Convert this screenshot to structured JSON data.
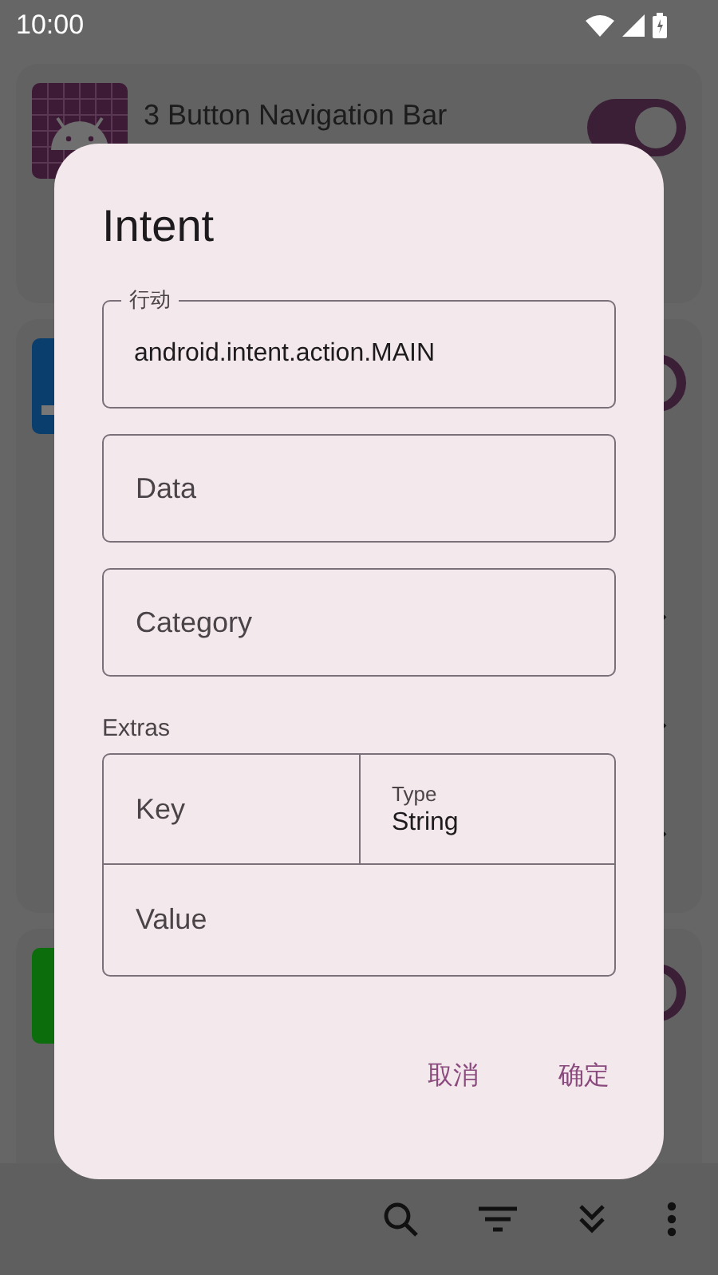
{
  "status_bar": {
    "time": "10:00"
  },
  "cards": [
    {
      "kind": "app",
      "title": "3 Button Navigation Bar",
      "toggle": {
        "on": true
      }
    },
    {
      "kind": "sections",
      "toggle": {
        "on": true
      }
    },
    {
      "kind": "app",
      "toggle": {
        "on": true
      }
    }
  ],
  "dialog": {
    "title": "Intent",
    "fields": [
      {
        "label": "行动",
        "value": "android.intent.action.MAIN"
      },
      {
        "placeholder": "Data"
      },
      {
        "placeholder": "Category"
      }
    ],
    "extras": {
      "label": "Extras",
      "key": {
        "placeholder": "Key"
      },
      "type": {
        "label": "Type",
        "value": "String"
      },
      "value": {
        "placeholder": "Value"
      }
    },
    "buttons": [
      "取消",
      "确定"
    ]
  }
}
